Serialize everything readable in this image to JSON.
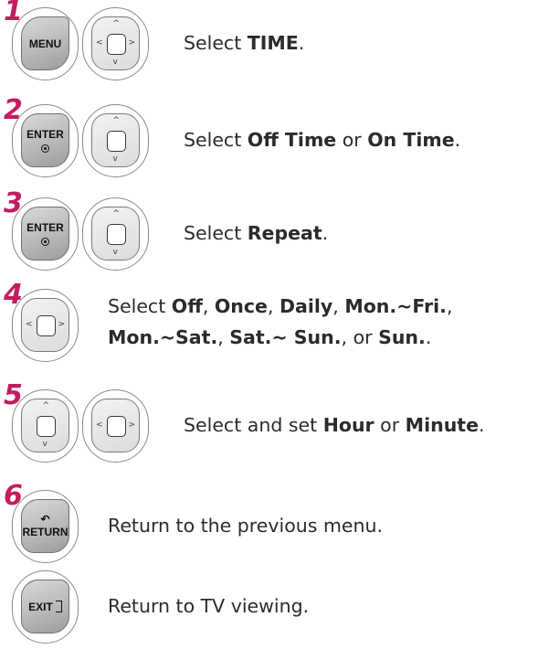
{
  "steps": [
    {
      "number": "1",
      "buttons": [
        "menu-key",
        "nav-four-way"
      ],
      "text_before": "Select ",
      "bold1": "TIME",
      "text_after": "."
    },
    {
      "number": "2",
      "buttons": [
        "enter-key",
        "nav-up-down"
      ],
      "text_before": "Select ",
      "bold1": "Off Time",
      "mid": " or ",
      "bold2": "On Time",
      "text_after": "."
    },
    {
      "number": "3",
      "buttons": [
        "enter-key",
        "nav-up-down"
      ],
      "text_before": "Select ",
      "bold1": "Repeat",
      "text_after": "."
    },
    {
      "number": "4",
      "buttons": [
        "nav-left-right"
      ],
      "line1": {
        "pre": "Select ",
        "b1": "Off",
        "s1": ", ",
        "b2": "Once",
        "s2": ", ",
        "b3": "Daily",
        "s3": ", ",
        "b4": "Mon.~Fri.",
        "s4": ","
      },
      "line2": {
        "b1": "Mon.~Sat.",
        "s1": ", ",
        "b2": "Sat.~ Sun.",
        "s2": ", or ",
        "b3": "Sun.",
        "s3": "."
      }
    },
    {
      "number": "5",
      "buttons": [
        "nav-up-down",
        "nav-left-right"
      ],
      "text_before": "Select and set ",
      "bold1": "Hour",
      "mid": " or ",
      "bold2": "Minute",
      "text_after": "."
    },
    {
      "number": "6",
      "buttons": [
        "return-key"
      ],
      "text": "Return to the previous menu."
    },
    {
      "buttons": [
        "exit-key"
      ],
      "text": "Return to TV viewing."
    }
  ],
  "keys": {
    "menu": "MENU",
    "enter": "ENTER",
    "return": "RETURN",
    "exit": "EXIT"
  },
  "colors": {
    "step_number": "#c21d5d",
    "text": "#2b2b2b",
    "key_gray": "#b9b9b9"
  }
}
